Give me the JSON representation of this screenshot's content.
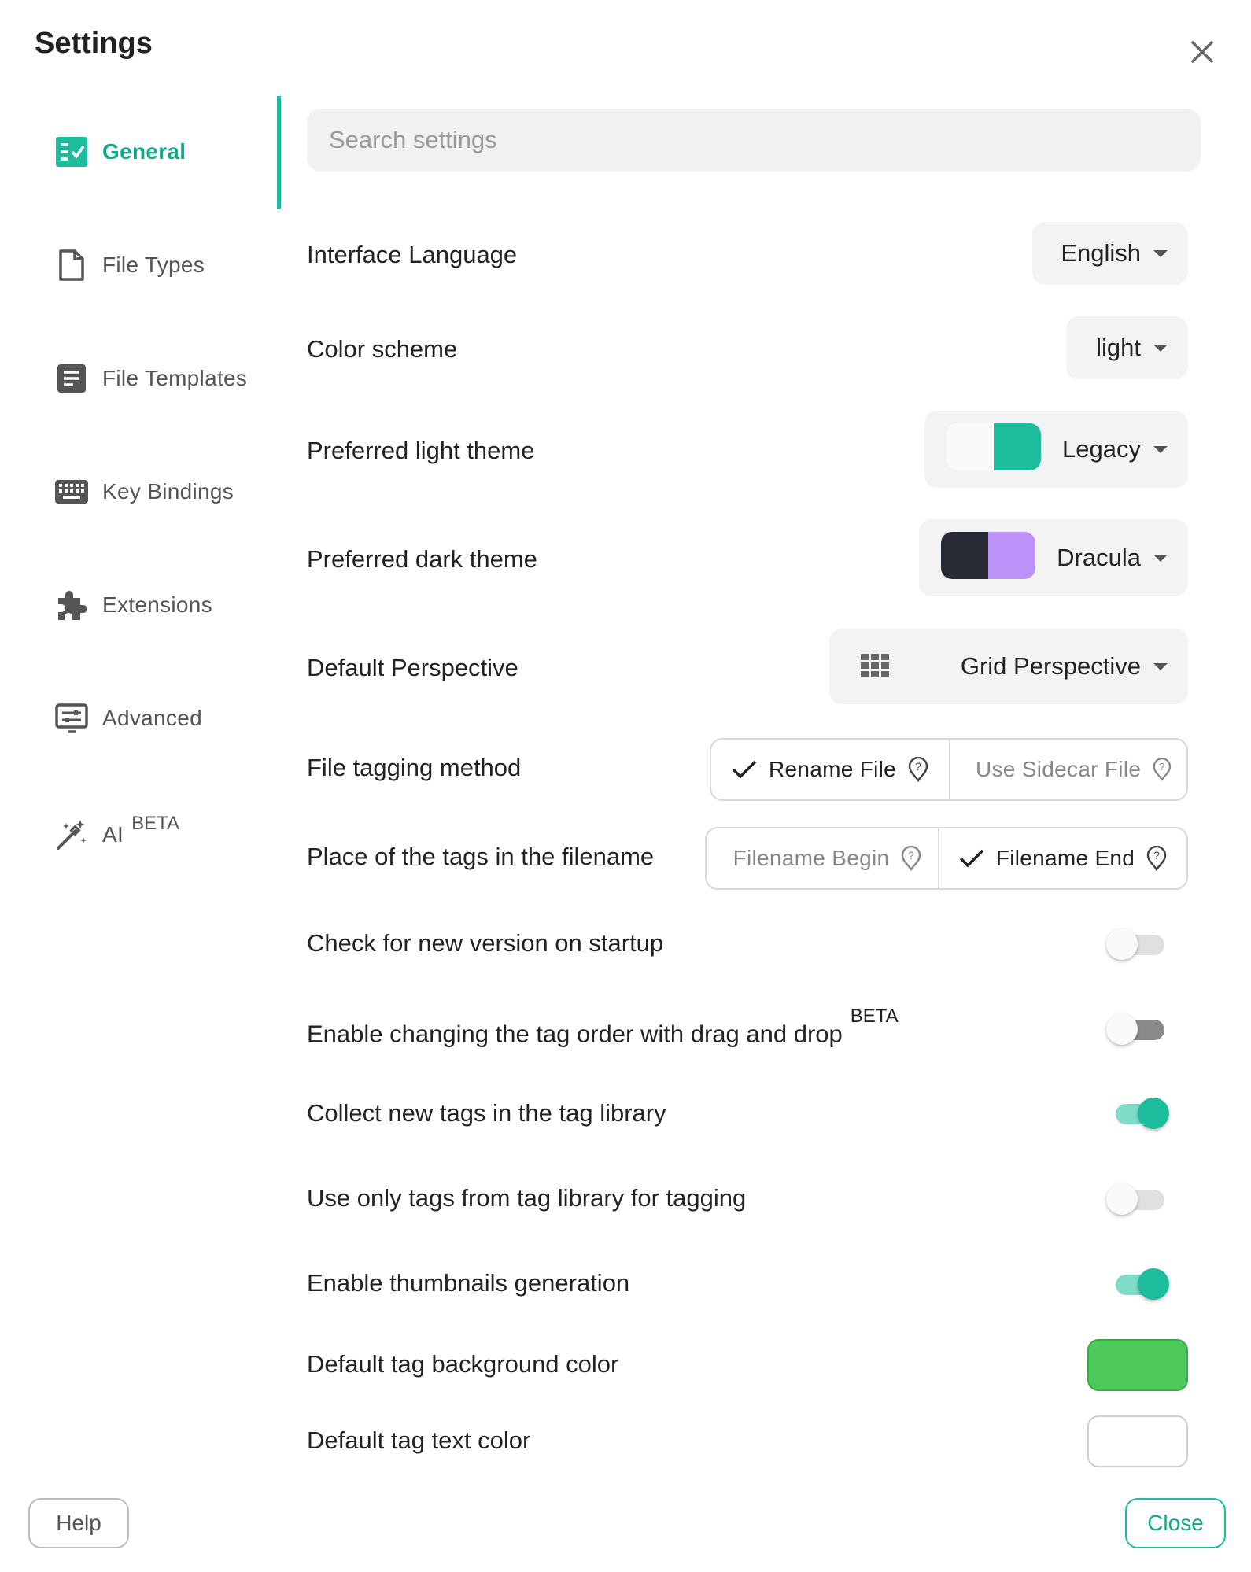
{
  "dialog": {
    "title": "Settings"
  },
  "sidebar": {
    "items": [
      {
        "label": "General",
        "icon": "checklist-icon",
        "active": true
      },
      {
        "label": "File Types",
        "icon": "file-icon"
      },
      {
        "label": "File Templates",
        "icon": "document-icon"
      },
      {
        "label": "Key Bindings",
        "icon": "keyboard-icon"
      },
      {
        "label": "Extensions",
        "icon": "puzzle-icon"
      },
      {
        "label": "Advanced",
        "icon": "settings-panel-icon"
      },
      {
        "label": "AI",
        "badge": "BETA",
        "icon": "magic-wand-icon"
      }
    ]
  },
  "search": {
    "placeholder": "Search settings"
  },
  "settings": {
    "interface_language": {
      "label": "Interface Language",
      "value": "English"
    },
    "color_scheme": {
      "label": "Color scheme",
      "value": "light"
    },
    "light_theme": {
      "label": "Preferred light theme",
      "value": "Legacy",
      "colors": [
        "#fafafa",
        "#1dbc9c"
      ]
    },
    "dark_theme": {
      "label": "Preferred dark theme",
      "value": "Dracula",
      "colors": [
        "#282a36",
        "#bd93f9"
      ]
    },
    "perspective": {
      "label": "Default Perspective",
      "value": "Grid Perspective",
      "icon": "grid-icon"
    },
    "tagging_method": {
      "label": "File tagging method",
      "options": [
        "Rename File",
        "Use Sidecar File"
      ],
      "selected": "Rename File"
    },
    "tag_place": {
      "label": "Place of the tags in the filename",
      "options": [
        "Filename Begin",
        "Filename End"
      ],
      "selected": "Filename End"
    },
    "check_version": {
      "label": "Check for new version on startup",
      "enabled": false
    },
    "drag_drop_order": {
      "label": "Enable changing the tag order with drag and drop",
      "badge": "BETA",
      "enabled": false
    },
    "collect_tags": {
      "label": "Collect new tags in the tag library",
      "enabled": true
    },
    "only_library_tags": {
      "label": "Use only tags from tag library for tagging",
      "enabled": false
    },
    "thumbnails": {
      "label": "Enable thumbnails generation",
      "enabled": true
    },
    "tag_bg_color": {
      "label": "Default tag background color",
      "value": "#4cc95a"
    },
    "tag_text_color": {
      "label": "Default tag text color",
      "value": "#ffffff"
    }
  },
  "footer": {
    "help_label": "Help",
    "close_label": "Close"
  },
  "colors": {
    "accent": "#1dbc9c",
    "accent_dark": "#14a88b"
  }
}
